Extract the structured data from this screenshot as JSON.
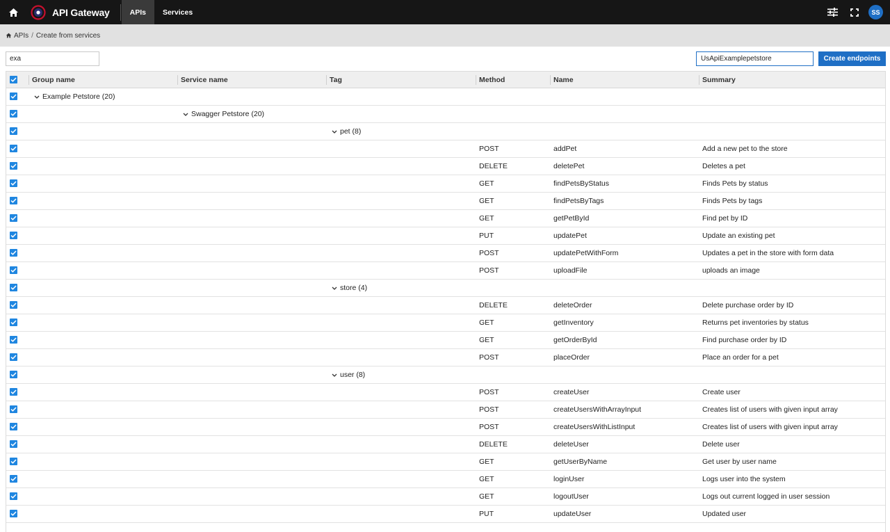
{
  "app": {
    "title": "API Gateway"
  },
  "nav": {
    "tabs": [
      {
        "label": "APIs"
      },
      {
        "label": "Services"
      }
    ]
  },
  "user": {
    "initials": "SS"
  },
  "breadcrumb": {
    "items": [
      "APIs",
      "Create from services"
    ]
  },
  "toolbar": {
    "search_value": "exa",
    "api_name_value": "UsApiExamplepetstore",
    "create_label": "Create endpoints"
  },
  "table": {
    "columns": [
      "Group name",
      "Service name",
      "Tag",
      "Method",
      "Name",
      "Summary"
    ],
    "group": "Example Petstore (20)",
    "service": "Swagger Petstore (20)",
    "tags": [
      {
        "label": "pet (8)",
        "rows": [
          [
            "POST",
            "addPet",
            "Add a new pet to the store"
          ],
          [
            "DELETE",
            "deletePet",
            "Deletes a pet"
          ],
          [
            "GET",
            "findPetsByStatus",
            "Finds Pets by status"
          ],
          [
            "GET",
            "findPetsByTags",
            "Finds Pets by tags"
          ],
          [
            "GET",
            "getPetById",
            "Find pet by ID"
          ],
          [
            "PUT",
            "updatePet",
            "Update an existing pet"
          ],
          [
            "POST",
            "updatePetWithForm",
            "Updates a pet in the store with form data"
          ],
          [
            "POST",
            "uploadFile",
            "uploads an image"
          ]
        ]
      },
      {
        "label": "store (4)",
        "rows": [
          [
            "DELETE",
            "deleteOrder",
            "Delete purchase order by ID"
          ],
          [
            "GET",
            "getInventory",
            "Returns pet inventories by status"
          ],
          [
            "GET",
            "getOrderById",
            "Find purchase order by ID"
          ],
          [
            "POST",
            "placeOrder",
            "Place an order for a pet"
          ]
        ]
      },
      {
        "label": "user (8)",
        "rows": [
          [
            "POST",
            "createUser",
            "Create user"
          ],
          [
            "POST",
            "createUsersWithArrayInput",
            "Creates list of users with given input array"
          ],
          [
            "POST",
            "createUsersWithListInput",
            "Creates list of users with given input array"
          ],
          [
            "DELETE",
            "deleteUser",
            "Delete user"
          ],
          [
            "GET",
            "getUserByName",
            "Get user by user name"
          ],
          [
            "GET",
            "loginUser",
            "Logs user into the system"
          ],
          [
            "GET",
            "logoutUser",
            "Logs out current logged in user session"
          ],
          [
            "PUT",
            "updateUser",
            "Updated user"
          ]
        ]
      }
    ]
  },
  "colors": {
    "accent": "#1f6fc5",
    "topbar": "#161616",
    "checkbox": "#1f86e0"
  }
}
